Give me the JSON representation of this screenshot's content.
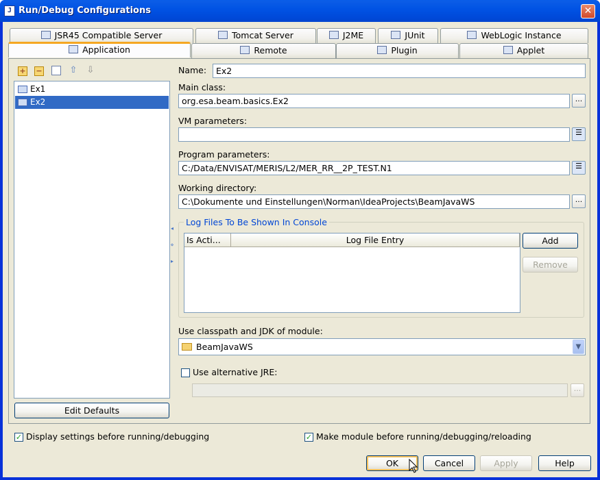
{
  "window": {
    "title": "Run/Debug Configurations"
  },
  "tabs_row1": [
    {
      "label": "JSR45 Compatible Server",
      "icon": "jsr45-icon"
    },
    {
      "label": "Tomcat Server",
      "icon": "tomcat-icon"
    },
    {
      "label": "J2ME",
      "icon": "j2me-icon"
    },
    {
      "label": "JUnit",
      "icon": "junit-icon"
    },
    {
      "label": "WebLogic Instance",
      "icon": "weblogic-icon"
    }
  ],
  "tabs_row2": [
    {
      "label": "Application",
      "icon": "application-icon",
      "active": true
    },
    {
      "label": "Remote",
      "icon": "remote-icon"
    },
    {
      "label": "Plugin",
      "icon": "plugin-icon"
    },
    {
      "label": "Applet",
      "icon": "applet-icon"
    }
  ],
  "config_list": {
    "items": [
      {
        "label": "Ex1",
        "selected": false
      },
      {
        "label": "Ex2",
        "selected": true
      }
    ],
    "edit_defaults": "Edit Defaults"
  },
  "form": {
    "name_label": "Name:",
    "name_value": "Ex2",
    "main_class_label": "Main class:",
    "main_class_value": "org.esa.beam.basics.Ex2",
    "vm_label": "VM parameters:",
    "vm_value": "",
    "program_label": "Program parameters:",
    "program_value": "C:/Data/ENVISAT/MERIS/L2/MER_RR__2P_TEST.N1",
    "workdir_label": "Working directory:",
    "workdir_value": "C:\\Dokumente und Einstellungen\\Norman\\IdeaProjects\\BeamJavaWS",
    "browse": "...",
    "log_group_title": "Log Files To Be Shown In Console",
    "log_col_active": "Is Acti...",
    "log_col_entry": "Log File Entry",
    "add": "Add",
    "remove": "Remove",
    "module_label": "Use classpath and JDK of module:",
    "module_value": "BeamJavaWS",
    "alt_jre_label": "Use alternative JRE:",
    "alt_jre_value": ""
  },
  "footer": {
    "display_settings": "Display settings before running/debugging",
    "make_module": "Make module before running/debugging/reloading",
    "ok": "OK",
    "cancel": "Cancel",
    "apply": "Apply",
    "help": "Help"
  }
}
